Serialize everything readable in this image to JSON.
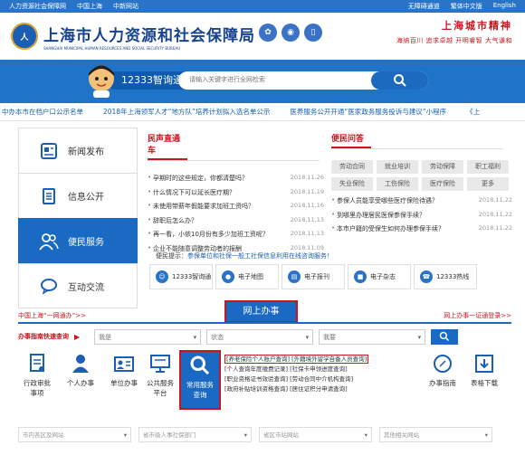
{
  "topbar": {
    "left": [
      "人力资源社会保障网",
      "中国上海",
      "中新网站"
    ],
    "right": [
      "无障碍通道",
      "繁体中文版",
      "English"
    ]
  },
  "header": {
    "title": "上海市人力资源和社会保障局",
    "subtitle_en": "SHANGHAI MUNICIPAL HUMAN RESOURCES AND SOCIAL SECURITY BUREAU",
    "city_spirit": "上海城市精神",
    "city_values": "海纳百川  追求卓越  开明睿智  大气谦和"
  },
  "search": {
    "badge": "12333智询通",
    "placeholder": "请输入关键字进行全网检索"
  },
  "ticker": [
    "中办本市在档户口公示名单",
    "2018年上海领军人才“地方队”培养计划拟入选名单公示",
    "医养服务公开开通“医家政务服务投诉与建议”小程序",
    "《上"
  ],
  "sidenav": [
    {
      "label": "新闻发布",
      "icon": "news-icon"
    },
    {
      "label": "信息公开",
      "icon": "document-icon"
    },
    {
      "label": "便民服务",
      "icon": "people-icon"
    },
    {
      "label": "互动交流",
      "icon": "chat-icon"
    }
  ],
  "news": {
    "tab": "民声直通车",
    "items": [
      {
        "t": "孕期时的这些规定，你都清楚吗？",
        "d": "2018.11.26"
      },
      {
        "t": "什么情况下可以延长医疗期？",
        "d": "2018.11.19"
      },
      {
        "t": "未使用带薪年假能要求加班工资吗？",
        "d": "2018.11.16"
      },
      {
        "t": "辞职后怎么办？",
        "d": "2018.11.13"
      },
      {
        "t": "再一看，小依10月份有多少加班工资呢？",
        "d": "2018.11.13"
      },
      {
        "t": "企业不能随意调整劳动者的报酬",
        "d": "2018.11.09"
      }
    ]
  },
  "bianmin": {
    "tab": "便民问答",
    "chips": [
      "劳动合同",
      "就业培训",
      "劳动保障",
      "职工福利",
      "失业保险",
      "工伤保险",
      "医疗保险",
      "更多"
    ],
    "items": [
      {
        "t": "参保人员能享受哪些医疗保险待遇？",
        "d": "2018.11.22"
      },
      {
        "t": "到哪里办理居民医保参保手续？",
        "d": "2018.11.22"
      },
      {
        "t": "本市户籍的受保生如何办理参保手续？",
        "d": "2018.11.22"
      }
    ]
  },
  "tip": {
    "label": "便民提示：",
    "text": "参保单位和社保一般工社保信息利用在线咨询服务！"
  },
  "quicklinks": [
    "12333智询通",
    "电子地图",
    "电子报刊",
    "电子杂志",
    "12333热线"
  ],
  "workbar": {
    "left": "中国上海“一网通办”>>",
    "title": "网上办事",
    "right": "网上办事一证通登录>>"
  },
  "fastbar": {
    "label": "办事指南快速查询",
    "selects": [
      "我是",
      "状态",
      "我要"
    ]
  },
  "services": [
    {
      "label": "行政审批\n事项",
      "icon": "approval-icon"
    },
    {
      "label": "个人办事",
      "icon": "person-icon"
    },
    {
      "label": "单位办事",
      "icon": "office-icon"
    },
    {
      "label": "公共服务\n平台",
      "icon": "monitor-icon"
    },
    {
      "label": "常用服务\n查询",
      "icon": "search-icon"
    },
    {
      "label": "办事指南",
      "icon": "compass-icon"
    },
    {
      "label": "表格下载",
      "icon": "download-icon"
    }
  ],
  "svcsub": [
    "[养老保险个人账户查询] [外籍境外留学自备人员查询]",
    "[个人查询年度缴费记录] [社保卡申领进度查询]",
    "[职业资格证书效验查询] [劳动合同中介机构查询]",
    "[政府补贴培训资格查询] [居住证积分申请查询]"
  ],
  "bottomselects": [
    "市内各区及网站",
    "省市级人事社保部门",
    "省区市站网站",
    "其他相关网站"
  ]
}
